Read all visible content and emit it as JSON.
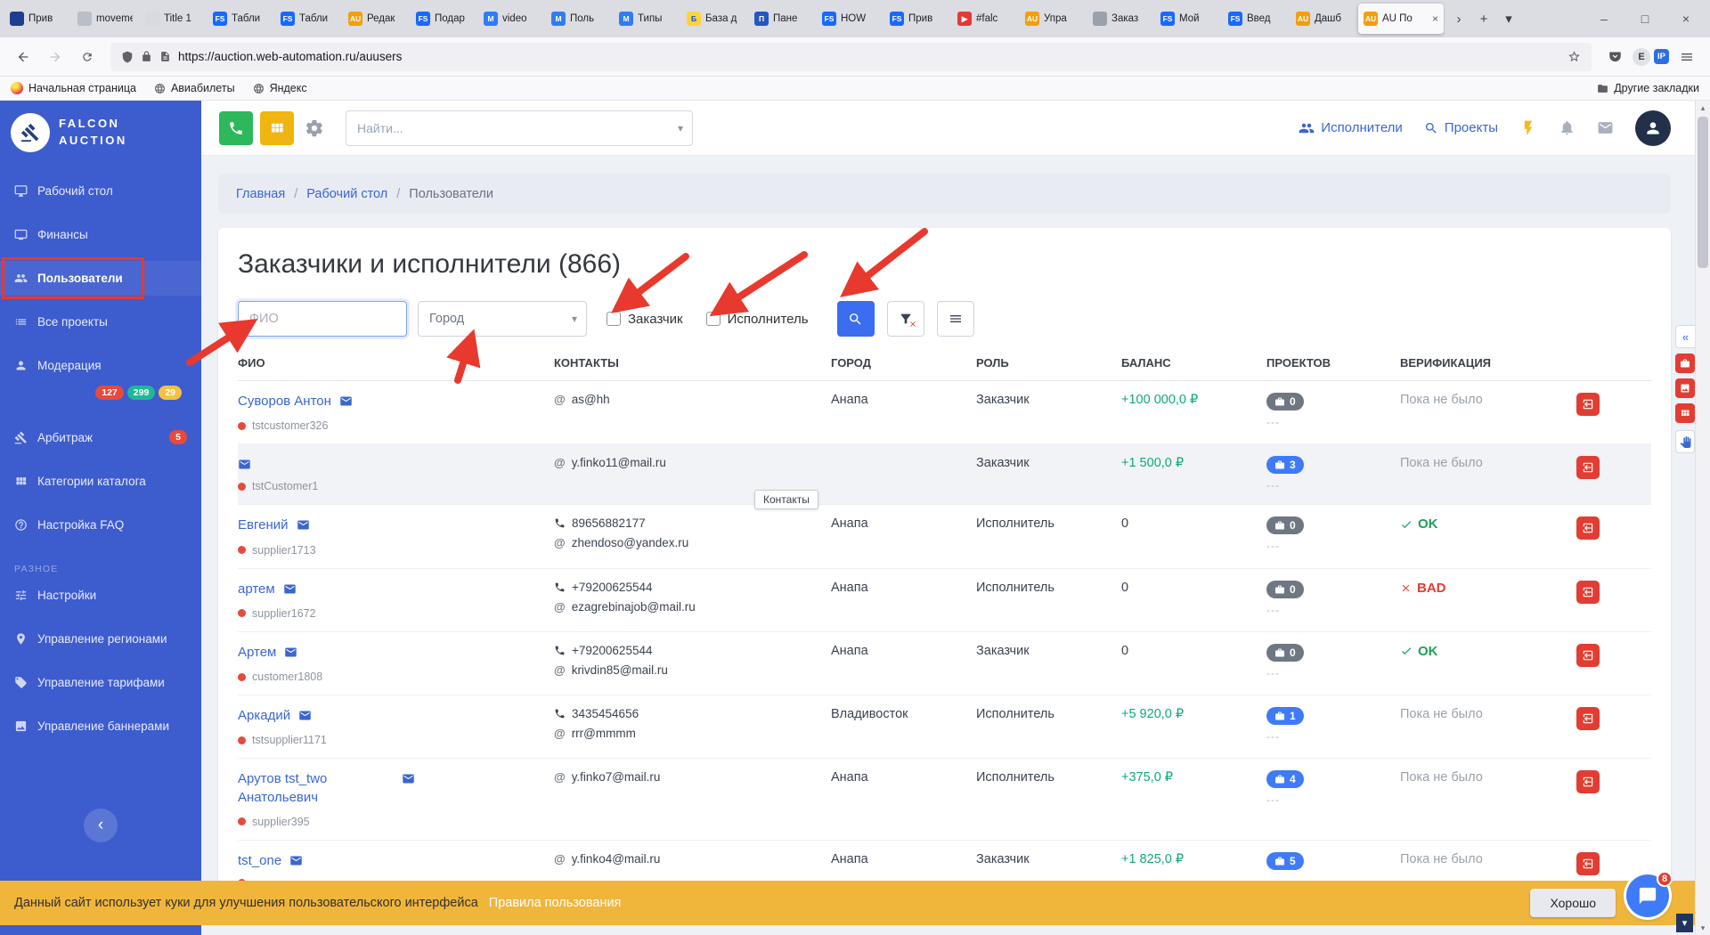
{
  "browser": {
    "tabs": [
      {
        "label": "Прив",
        "fav": {
          "t": "",
          "bg": "#1d3f8f",
          "fg": "#ffffff"
        }
      },
      {
        "label": "movemen",
        "fav": {
          "t": "",
          "bg": "#b9bec7",
          "fg": "#ffffff"
        }
      },
      {
        "label": "Title 1",
        "fav": {
          "t": "",
          "bg": "#d7dade",
          "fg": "#666666"
        }
      },
      {
        "label": "Табли",
        "fav": {
          "t": "FS",
          "bg": "#1769ff",
          "fg": "#ffffff"
        }
      },
      {
        "label": "Табли",
        "fav": {
          "t": "FS",
          "bg": "#1769ff",
          "fg": "#ffffff"
        }
      },
      {
        "label": "Редак",
        "fav": {
          "t": "AU",
          "bg": "#f59e0b",
          "fg": "#ffffff"
        }
      },
      {
        "label": "Подар",
        "fav": {
          "t": "FS",
          "bg": "#1769ff",
          "fg": "#ffffff"
        }
      },
      {
        "label": "video",
        "fav": {
          "t": "M",
          "bg": "#2f7df6",
          "fg": "#ffffff"
        }
      },
      {
        "label": "Поль",
        "fav": {
          "t": "M",
          "bg": "#2f7df6",
          "fg": "#ffffff"
        }
      },
      {
        "label": "Типы",
        "fav": {
          "t": "M",
          "bg": "#2f7df6",
          "fg": "#ffffff"
        }
      },
      {
        "label": "База д",
        "fav": {
          "t": "Б",
          "bg": "#ffd43b",
          "fg": "#1c4ed8"
        }
      },
      {
        "label": "Пане",
        "fav": {
          "t": "П",
          "bg": "#2456c4",
          "fg": "#ffffff"
        }
      },
      {
        "label": "HOW",
        "fav": {
          "t": "FS",
          "bg": "#1769ff",
          "fg": "#ffffff"
        }
      },
      {
        "label": "Прив",
        "fav": {
          "t": "FS",
          "bg": "#1769ff",
          "fg": "#ffffff"
        }
      },
      {
        "label": "#falc",
        "fav": {
          "t": "▶",
          "bg": "#e53935",
          "fg": "#ffffff"
        }
      },
      {
        "label": "Упра",
        "fav": {
          "t": "AU",
          "bg": "#f59e0b",
          "fg": "#ffffff"
        }
      },
      {
        "label": "Заказ",
        "fav": {
          "t": "",
          "bg": "#9aa0ac",
          "fg": "#ffffff"
        }
      },
      {
        "label": "Мой",
        "fav": {
          "t": "FS",
          "bg": "#1769ff",
          "fg": "#ffffff"
        }
      },
      {
        "label": "Введ",
        "fav": {
          "t": "FS",
          "bg": "#1769ff",
          "fg": "#ffffff"
        }
      },
      {
        "label": "Дашб",
        "fav": {
          "t": "AU",
          "bg": "#f59e0b",
          "fg": "#ffffff"
        }
      },
      {
        "label": "AU По",
        "active": true,
        "fav": {
          "t": "AU",
          "bg": "#f59e0b",
          "fg": "#ffffff"
        }
      }
    ],
    "tab_close": "×",
    "overflow": "›",
    "new_tab": "+",
    "tab_list": "▾",
    "win_min": "–",
    "win_max": "□",
    "win_close": "×",
    "url": "https://auction.web-automation.ru/auusers",
    "ext1": "E",
    "ext2": "IP",
    "bookmarks": [
      {
        "label": "Начальная страница",
        "icon": "firefox"
      },
      {
        "label": "Авиабилеты",
        "icon": "globe"
      },
      {
        "label": "Яндекс",
        "icon": "globe"
      }
    ],
    "other_bookmarks": "Другие закладки"
  },
  "sidebar": {
    "brand1": "FALCON",
    "brand2": "AUCTION",
    "collapse_glyph": "‹",
    "items": [
      {
        "label": "Рабочий стол",
        "icon": "desktop"
      },
      {
        "label": "Финансы",
        "icon": "tv"
      },
      {
        "label": "Пользователи",
        "icon": "group",
        "active": true,
        "annotated": true
      },
      {
        "label": "Все проекты",
        "icon": "list"
      },
      {
        "label": "Модерация",
        "icon": "person",
        "badges": [
          {
            "text": "127",
            "color": "#e74a3b"
          },
          {
            "text": "299",
            "color": "#21b795"
          },
          {
            "text": "29",
            "color": "#f6c23e"
          }
        ]
      },
      {
        "label": "Арбитраж",
        "icon": "gavel",
        "inline_badge": true,
        "badges": [
          {
            "text": "5",
            "color": "#e74a3b"
          }
        ]
      },
      {
        "label": "Категории каталога",
        "icon": "grid"
      },
      {
        "label": "Настройка FAQ",
        "icon": "question"
      },
      {
        "section": "РАЗНОЕ"
      },
      {
        "label": "Настройки",
        "icon": "tune"
      },
      {
        "label": "Управление регионами",
        "icon": "pin"
      },
      {
        "label": "Управление тарифами",
        "icon": "tag"
      },
      {
        "label": "Управление баннерами",
        "icon": "image"
      }
    ]
  },
  "topbar": {
    "search_placeholder": "Найти...",
    "performers": "Исполнители",
    "projects": "Проекты"
  },
  "breadcrumb": {
    "items": [
      "Главная",
      "Рабочий стол",
      "Пользователи"
    ],
    "sep": "/"
  },
  "page": {
    "title": "Заказчики и исполнители",
    "count": "(866)",
    "filters": {
      "fio": "ФИО",
      "city": "Город",
      "customer": "Заказчик",
      "performer": "Исполнитель"
    },
    "table": {
      "at_glyph": "@",
      "headers": [
        "ФИО",
        "КОНТАКТЫ",
        "ГОРОД",
        "РОЛЬ",
        "БАЛАНС",
        "ПРОЕКТОВ",
        "ВЕРИФИКАЦИЯ"
      ],
      "rows": [
        {
          "name": "Суворов Антон",
          "username": "tstcustomer326",
          "email": "as@hh",
          "city": "Анапа",
          "role": "Заказчик",
          "balance": "+100 000,0 ₽",
          "positive": true,
          "projects": "0",
          "projects_sub": "---",
          "verification": {
            "type": "none",
            "text": "Пока не было"
          }
        },
        {
          "name": "",
          "username": "tstCustomer1",
          "email": "y.finko11@mail.ru",
          "tooltip": "Контакты",
          "highlight": true,
          "city": "",
          "role": "Заказчик",
          "balance": "+1 500,0 ₽",
          "positive": true,
          "projects": "3",
          "projects_sub": "---",
          "verification": {
            "type": "none",
            "text": "Пока не было"
          }
        },
        {
          "name": "Евгений",
          "username": "supplier1713",
          "phone": "89656882177",
          "email": "zhendoso@yandex.ru",
          "city": "Анапа",
          "role": "Исполнитель",
          "balance": "0",
          "projects": "0",
          "projects_sub": "---",
          "verification": {
            "type": "ok",
            "text": "OK"
          }
        },
        {
          "name": "артем",
          "username": "supplier1672",
          "phone": "+79200625544",
          "email": "ezagrebinajob@mail.ru",
          "city": "Анапа",
          "role": "Исполнитель",
          "balance": "0",
          "projects": "0",
          "projects_sub": "---",
          "verification": {
            "type": "bad",
            "text": "BAD"
          }
        },
        {
          "name": "Артем",
          "username": "customer1808",
          "phone": "+79200625544",
          "email": "krivdin85@mail.ru",
          "city": "Анапа",
          "role": "Заказчик",
          "balance": "0",
          "projects": "0",
          "projects_sub": "---",
          "verification": {
            "type": "ok",
            "text": "OK"
          }
        },
        {
          "name": "Аркадий",
          "username": "tstsupplier1171",
          "phone": "3435454656",
          "email": "rrr@mmmm",
          "city": "Владивосток",
          "role": "Исполнитель",
          "balance": "+5 920,0 ₽",
          "positive": true,
          "projects": "1",
          "projects_sub": "---",
          "verification": {
            "type": "none",
            "text": "Пока не было"
          }
        },
        {
          "name": "Арутов tst_two Анатольевич",
          "username": "supplier395",
          "email": "y.finko7@mail.ru",
          "city": "Анапа",
          "role": "Исполнитель",
          "balance": "+375,0 ₽",
          "positive": true,
          "projects": "4",
          "projects_sub": "---",
          "verification": {
            "type": "none",
            "text": "Пока не было"
          }
        },
        {
          "name": "tst_one",
          "username": "",
          "email": "y.finko4@mail.ru",
          "city": "Анапа",
          "role": "Заказчик",
          "balance": "+1 825,0 ₽",
          "positive": true,
          "projects": "5",
          "projects_sub": "---",
          "verification": {
            "type": "none",
            "text": "Пока не было"
          }
        }
      ]
    }
  },
  "widgets": {
    "caret": "▾",
    "collapse": "«",
    "scroll": "▾",
    "up": "▴",
    "down": "▾"
  },
  "cookiebar": {
    "text": "Данный сайт использует куки для улучшения пользовательского интерфейса",
    "link": "Правила пользования",
    "button": "Хорошо",
    "chat_badge": "8"
  },
  "colors": {
    "sidebar": "#3d5cce",
    "accent": "#3a66d1",
    "green": "#0faa71",
    "red": "#e23d32",
    "amber": "#f0b63c"
  }
}
